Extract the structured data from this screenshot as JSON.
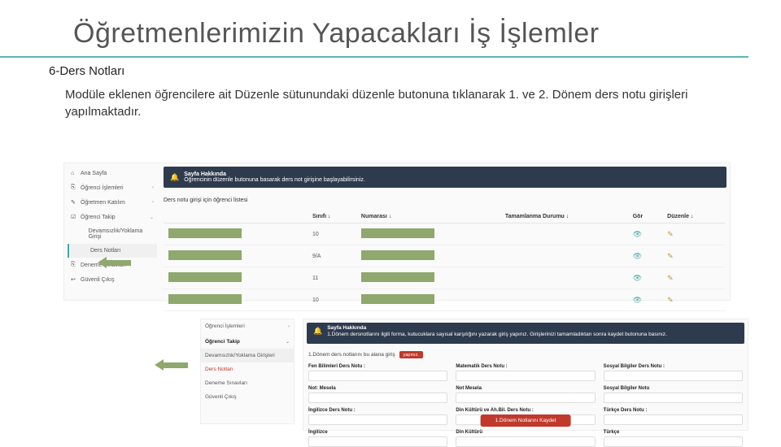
{
  "title": "Öğretmenlerimizin Yapacakları İş İşlemler",
  "subtitle": "6-Ders Notları",
  "body": "Modüle eklenen öğrencilere ait  Düzenle sütunundaki düzenle butonuna tıklanarak 1. ve 2. Dönem ders notu girişleri yapılmaktadır.",
  "shot1": {
    "sidebar": {
      "items": [
        {
          "label": "Ana Sayfa",
          "ico": "⌂"
        },
        {
          "label": "Öğrenci İşlemleri",
          "ico": "⎘",
          "chev": "›"
        },
        {
          "label": "Öğretmen Katılım",
          "ico": "✎",
          "chev": "›"
        },
        {
          "label": "Öğrenci Takip",
          "ico": "☑",
          "chev": "⌄",
          "open": true
        },
        {
          "label": "Devamsızlık/Yoklama Girişi",
          "ico": "",
          "sub": true
        },
        {
          "label": "Ders Notları",
          "ico": "",
          "sub": true,
          "sel": true
        },
        {
          "label": "Deneme Sınavları",
          "ico": "⎘"
        },
        {
          "label": "Güvenli Çıkış",
          "ico": "↩"
        }
      ]
    },
    "banner_title": "Sayfa Hakkında",
    "banner_text": "Öğrencinin düzenle butonuna basarak ders not girişine başlayabilirsiniz.",
    "list_head": "Ders notu girişi için öğrenci listesi",
    "columns": [
      "",
      "Sınıfı ↓",
      "Numarası ↓",
      "Tamamlanma Durumu ↓",
      "Gör",
      "Düzenle ↓"
    ],
    "rows": [
      {
        "sinif": "10",
        "view": "👁",
        "edit": "✎"
      },
      {
        "sinif": "9/A",
        "view": "👁",
        "edit": "✎"
      },
      {
        "sinif": "11",
        "view": "👁",
        "edit": "✎"
      },
      {
        "sinif": "10",
        "view": "👁",
        "edit": "✎"
      }
    ]
  },
  "shot2": {
    "items": [
      {
        "label": "Öğrenci İşlemleri",
        "chev": "›"
      },
      {
        "label": "Öğrenci Takip",
        "blk": true,
        "chev": "⌄"
      },
      {
        "label": "Devamsızlık/Yoklama Girişleri",
        "sel": true
      },
      {
        "label": "Ders Notları",
        "red": true
      },
      {
        "label": "Deneme Sınavları"
      },
      {
        "label": "Güvenli Çıkış"
      }
    ]
  },
  "shot3": {
    "banner_title": "Sayfa Hakkında",
    "banner_text": "1.Dönem dersnotlarını ilgili forma, kutucuklara sayısal karşılığını yazarak giriş yapınız. Girişlerinizi tamamladıktan sonra kaydet butonuna basınız.",
    "section_label": "1.Dönem ders notlarını bu alana giriş",
    "section_btn": "yapınız.",
    "fields": [
      {
        "lbl": "Fen Bilimleri Ders Notu :",
        "val": ""
      },
      {
        "lbl": "Matematik Ders Notu :",
        "val": ""
      },
      {
        "lbl": "Sosyal Bilgiler Ders Notu :",
        "val": ""
      },
      {
        "lbl": "Not: Mesela",
        "val": ""
      },
      {
        "lbl": "Not Mesela",
        "val": ""
      },
      {
        "lbl": "Sosyal Bilgiler Notu",
        "val": ""
      },
      {
        "lbl": "İngilizce Ders Notu :",
        "val": ""
      },
      {
        "lbl": "Din Kültürü ve Ah.Bil. Ders Notu :",
        "val": ""
      },
      {
        "lbl": "Türkçe Ders Notu :",
        "val": ""
      },
      {
        "lbl": "İngilizce",
        "val": ""
      },
      {
        "lbl": "Din Kültürü",
        "val": ""
      },
      {
        "lbl": "Türkçe",
        "val": ""
      }
    ],
    "save": "1.Dönem Notlarını Kaydet"
  }
}
